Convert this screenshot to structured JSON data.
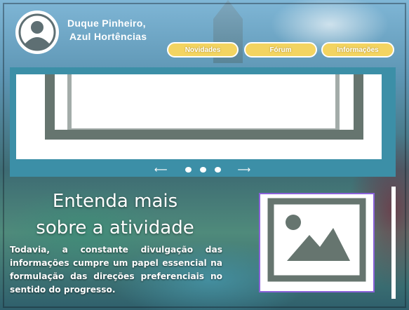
{
  "header": {
    "brand_line1": "Duque Pinheiro,",
    "brand_line2": "Azul Hortências",
    "avatar_icon": "user-avatar-icon"
  },
  "nav": {
    "items": [
      {
        "label": "Novidades"
      },
      {
        "label": "Fórum"
      },
      {
        "label": "Informações"
      }
    ],
    "color": "#f3d461"
  },
  "carousel": {
    "prev_arrow": "⟵",
    "next_arrow": "⟶",
    "dots": 3,
    "image_icon": "image-placeholder-icon",
    "background": "#3c8fa7"
  },
  "section": {
    "heading_line1": "Entenda mais",
    "heading_line2": "sobre a atividade",
    "paragraph": "Todavia, a constante divulgação das informações cumpre um papel essencial na formulação das direções preferenciais no sentido do progresso.",
    "image_icon": "image-placeholder-icon",
    "image_border": "#8a62d9"
  }
}
